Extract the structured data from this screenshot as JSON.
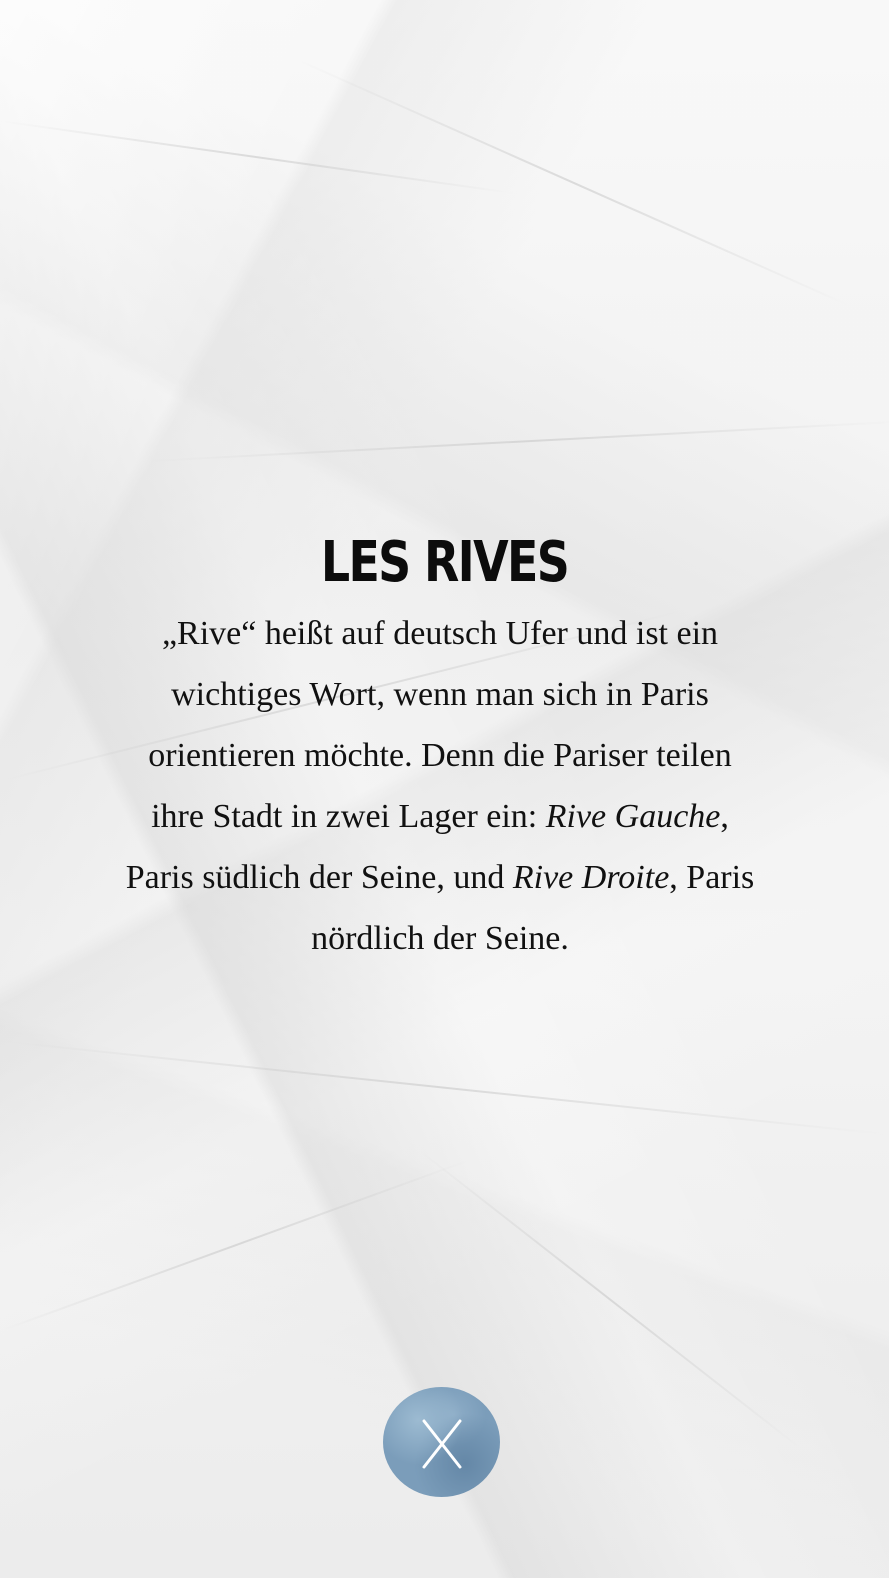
{
  "article": {
    "title": "LES RIVES",
    "lines": [
      {
        "before": "„Rive“ heißt auf deutsch Ufer und ist ein",
        "em": "",
        "after": ""
      },
      {
        "before": "wichtiges Wort, wenn man sich in Paris",
        "em": "",
        "after": ""
      },
      {
        "before": "orientieren möchte. Denn die Pariser teilen",
        "em": "",
        "after": ""
      },
      {
        "before": "ihre Stadt in zwei Lager ein: ",
        "em": "Rive Gauche",
        "after": ","
      },
      {
        "before": "Paris südlich der Seine, und ",
        "em": "Rive Droite",
        "after": ", Paris"
      },
      {
        "before": "nördlich der Seine.",
        "em": "",
        "after": ""
      }
    ]
  },
  "close_button": {
    "icon": "close-icon",
    "color": "#7b9dba"
  },
  "colors": {
    "paper": "#f1f1f1",
    "text": "#111111"
  }
}
